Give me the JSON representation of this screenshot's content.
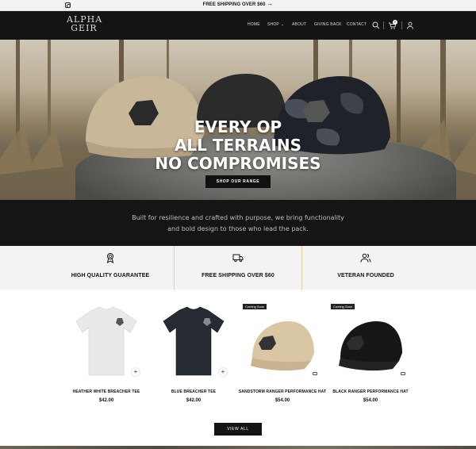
{
  "topbar": {
    "promo": "FREE SHIPPING OVER $60",
    "arrow": "→",
    "social_icon": "instagram-icon"
  },
  "nav": {
    "logo_line1": "ALPHA",
    "logo_line2": "GEIR",
    "menu": [
      "HOME",
      "SHOP",
      "ABOUT",
      "GIVING BACK",
      "CONTACT"
    ],
    "icons": [
      "search-icon",
      "cart-icon",
      "account-icon"
    ],
    "cart_count": "0"
  },
  "hero": {
    "line1": "EVERY OP",
    "line2": "ALL TERRAINS",
    "line3": "NO COMPROMISES",
    "cta": "SHOP OUR RANGE"
  },
  "tagline": "Built for resilience and crafted with purpose, we bring functionality and bold design to those who lead the pack.",
  "features": [
    {
      "icon": "award-ribbon-icon",
      "label": "HIGH QUALITY GUARANTEE"
    },
    {
      "icon": "delivery-truck-icon",
      "label": "FREE SHIPPING OVER $60"
    },
    {
      "icon": "users-icon",
      "label": "VETERAN FOUNDED"
    }
  ],
  "products": [
    {
      "name": "HEATHER WHITE BREACHER TEE",
      "price": "$42.00",
      "badge": ""
    },
    {
      "name": "BLUE BREACHER TEE",
      "price": "$42.00",
      "badge": ""
    },
    {
      "name": "SANDSTORM RANGER PERFORMANCE HAT",
      "price": "$54.00",
      "badge": "Coming Soon"
    },
    {
      "name": "BLACK RANGER PERFORMANCE HAT",
      "price": "$54.00",
      "badge": "Coming Soon"
    }
  ],
  "view_all": "VIEW ALL",
  "colors": {
    "dark": "#141414",
    "accent_line": "#e5cfa0",
    "feature_bg": "#f3f3f3"
  }
}
